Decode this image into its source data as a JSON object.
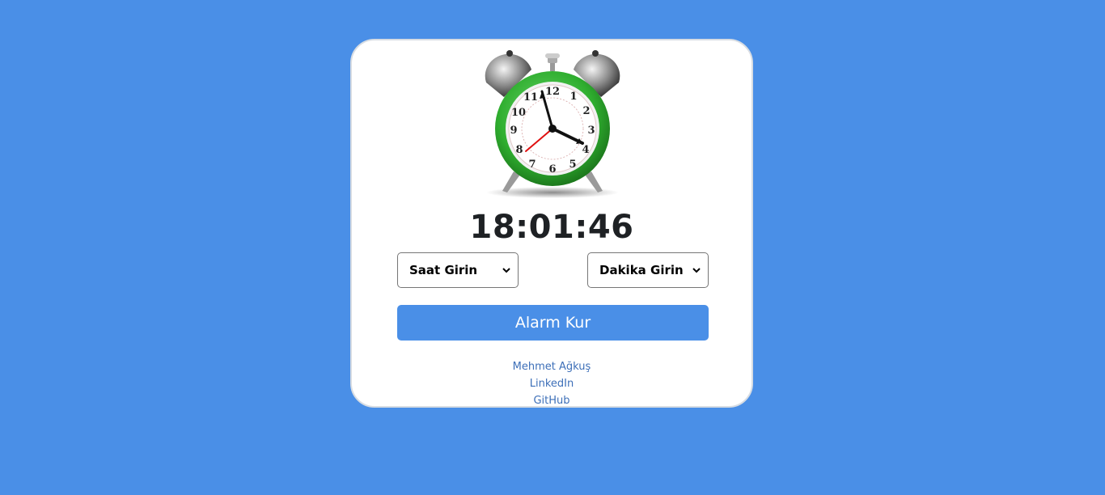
{
  "clock": {
    "time": "18:01:46"
  },
  "alarm_clock_image": {
    "icon": "alarm-clock-icon",
    "body_color": "#2fae2f",
    "hands": {
      "hour_hand": "4",
      "minute_hand": "11",
      "second_hand": "8"
    },
    "dial_numbers": [
      "12",
      "1",
      "2",
      "3",
      "4",
      "5",
      "6",
      "7",
      "8",
      "9",
      "10",
      "11"
    ]
  },
  "form": {
    "hour_select": {
      "selected": "Saat Girin"
    },
    "minute_select": {
      "selected": "Dakika Girin"
    },
    "set_alarm_label": "Alarm Kur"
  },
  "footer": {
    "links": [
      {
        "label": "Mehmet Ağkuş"
      },
      {
        "label": "LinkedIn"
      },
      {
        "label": "GitHub"
      }
    ]
  },
  "colors": {
    "background": "#4a8fe7",
    "button": "#4a8fe7",
    "link": "#3d6fb8",
    "card": "#ffffff"
  }
}
